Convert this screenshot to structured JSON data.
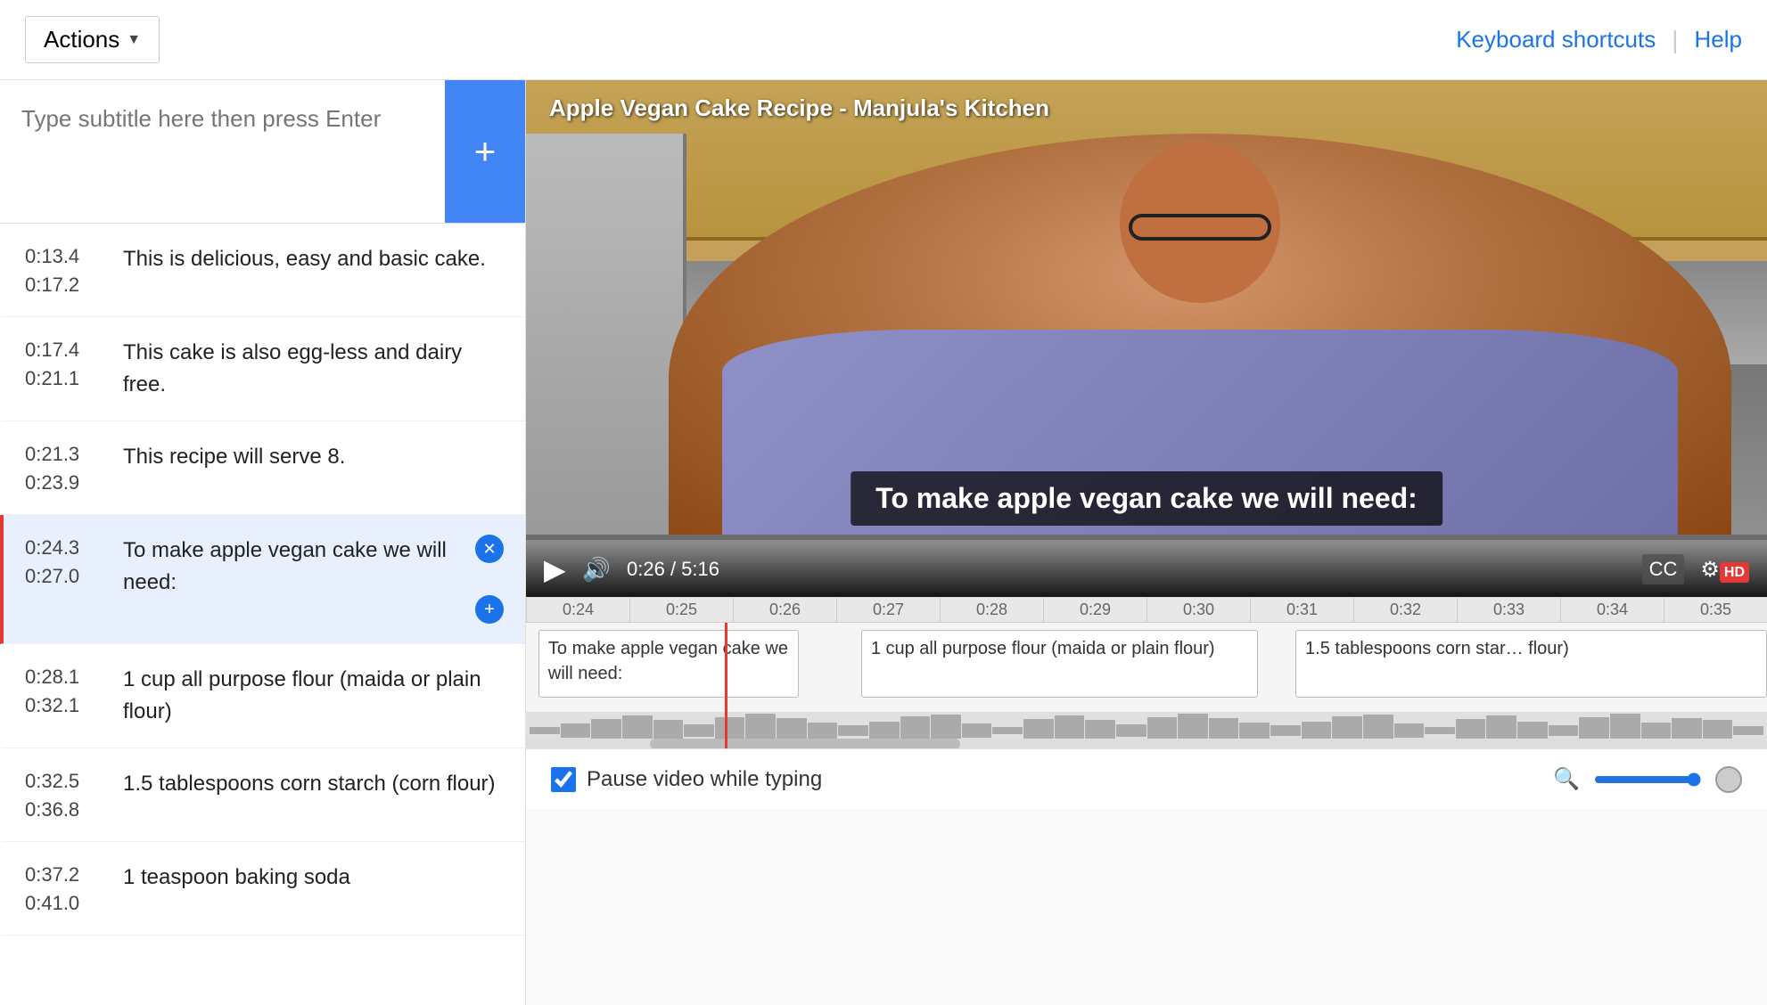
{
  "header": {
    "actions_label": "Actions",
    "keyboard_shortcuts": "Keyboard shortcuts",
    "help": "Help"
  },
  "subtitle_input": {
    "placeholder": "Type subtitle here then press Enter",
    "add_button": "+"
  },
  "subtitle_list": [
    {
      "start": "0:13.4",
      "end": "0:17.2",
      "text": "This is delicious, easy and basic cake.",
      "active": false
    },
    {
      "start": "0:17.4",
      "end": "0:21.1",
      "text": "This cake is also egg-less and dairy free.",
      "active": false
    },
    {
      "start": "0:21.3",
      "end": "0:23.9",
      "text": "This recipe will serve 8.",
      "active": false
    },
    {
      "start": "0:24.3",
      "end": "0:27.0",
      "text": "To make apple vegan cake we will need:",
      "active": true
    },
    {
      "start": "0:28.1",
      "end": "0:32.1",
      "text": "1 cup all purpose flour (maida or plain flour)",
      "active": false
    },
    {
      "start": "0:32.5",
      "end": "0:36.8",
      "text": "1.5 tablespoons corn starch (corn flour)",
      "active": false
    },
    {
      "start": "0:37.2",
      "end": "0:41.0",
      "text": "1 teaspoon baking soda",
      "active": false
    }
  ],
  "video": {
    "title": "Apple Vegan Cake Recipe - Manjula's Kitchen",
    "subtitle_overlay": "To make apple vegan cake we will need:",
    "current_time": "0:26",
    "total_time": "5:16",
    "progress_percent": 8.3
  },
  "timeline": {
    "ticks": [
      "0:24",
      "0:25",
      "0:26",
      "0:27",
      "0:28",
      "0:29",
      "0:30",
      "0:31",
      "0:32",
      "0:33",
      "0:34",
      "0:35"
    ],
    "captions": [
      {
        "label": "To make apple vegan cake we will need:",
        "left_percent": 1,
        "width_percent": 22
      },
      {
        "label": "1 cup all purpose flour (maida or plain flour)",
        "left_percent": 27,
        "width_percent": 33
      },
      {
        "label": "1.5 tablespoons corn star… flour)",
        "left_percent": 63,
        "width_percent": 35
      }
    ],
    "playhead_percent": 16
  },
  "bottom_bar": {
    "pause_video_label": "Pause video while typing"
  }
}
